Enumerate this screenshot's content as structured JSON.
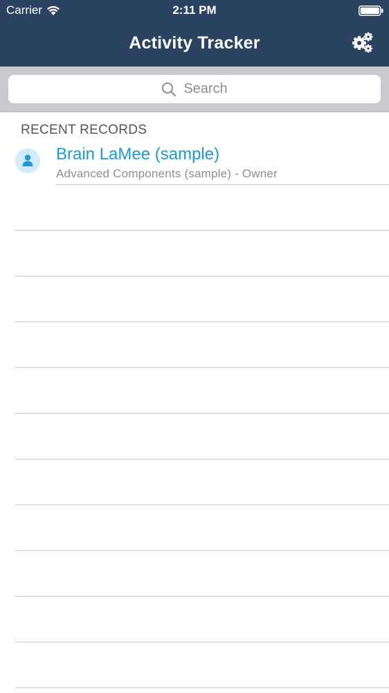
{
  "status_bar": {
    "carrier": "Carrier",
    "time": "2:11 PM"
  },
  "nav": {
    "title": "Activity Tracker",
    "settings_icon": "gears-icon"
  },
  "search": {
    "placeholder": "Search",
    "icon": "search-icon"
  },
  "recent": {
    "header": "RECENT RECORDS",
    "items": [
      {
        "title": "Brain LaMee (sample)",
        "subtitle": "Advanced Components (sample) - Owner",
        "icon": "person-icon"
      }
    ]
  },
  "colors": {
    "nav_background": "#2a4361",
    "search_background": "#c9c9ce",
    "link_blue": "#1a9bd7",
    "avatar_background": "#d4ecf8",
    "divider": "#c8c7cc"
  }
}
